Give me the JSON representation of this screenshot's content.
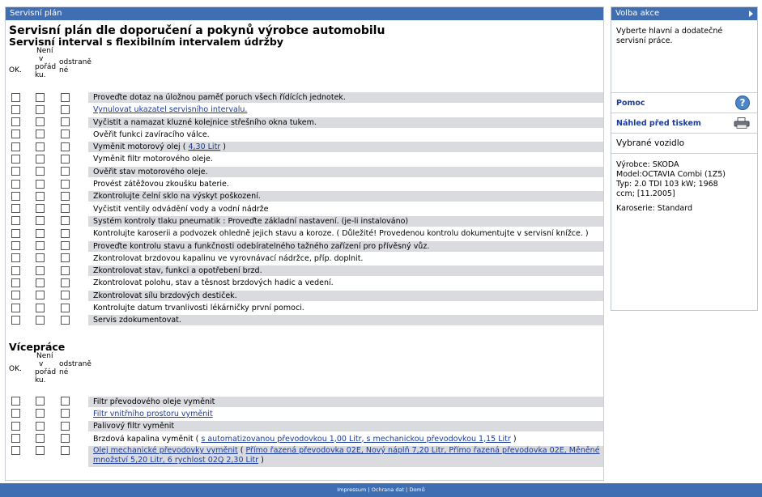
{
  "main": {
    "header": "Servisní plán",
    "title": "Servisní plán dle doporučení a pokynů výrobce automobilu",
    "subtitle": "Servisní interval s flexibilním intervalem údržby",
    "col_ok": "OK.",
    "col_neni_lines": [
      "Není",
      "v",
      "pořád",
      "ku."
    ],
    "col_odstranene_lines": [
      "odstraně",
      "né"
    ],
    "items": [
      {
        "text": "Proveďte dotaz na úložnou paměť poruch všech řídících jednotek."
      },
      {
        "link": "Vynulovat ukazatel servisního intervalu."
      },
      {
        "text": "Vyčistit a namazat kluzné kolejnice střešního okna tukem."
      },
      {
        "text": "Ověřit funkci zavíracího válce."
      },
      {
        "text": "Vyměnit motorový olej",
        "pre": "(",
        "link": "4,30 Litr",
        "post": ")"
      },
      {
        "text": "Vyměnit filtr motorového oleje."
      },
      {
        "text": "Ověřit stav motorového oleje."
      },
      {
        "text": "Provést zátěžovou zkoušku baterie."
      },
      {
        "text": "Zkontrolujte čelní sklo na výskyt poškození."
      },
      {
        "text": "Vyčistit ventily odvádění vody a vodní nádrže"
      },
      {
        "text": "Systém kontroly tlaku pneumatik : Proveďte základní nastavení. (je-li instalováno)"
      },
      {
        "text": "Kontrolujte karoserii a podvozek ohledně jejich stavu a koroze. ( Důležité! Provedenou kontrolu dokumentujte v servisní knížce. )"
      },
      {
        "text": "Proveďte kontrolu stavu a funkčnosti odebíratelného tažného zařízení pro přívěsný vůz."
      },
      {
        "text": "Zkontrolovat brzdovou kapalinu ve vyrovnávací nádržce, příp. doplnit."
      },
      {
        "text": "Zkontrolovat stav, funkci a opotřebení brzd."
      },
      {
        "text": "Zkontrolovat polohu, stav a těsnost brzdových hadic a vedení."
      },
      {
        "text": "Zkontrolovat sílu brzdových destiček."
      },
      {
        "text": "Kontrolujte datum trvanlivosti lékárničky první pomoci."
      },
      {
        "text": "Servis zdokumentovat."
      }
    ],
    "extra_title": "Vícepráce",
    "extra_items": [
      {
        "text": "Filtr převodového oleje vyměnit"
      },
      {
        "link": "Filtr vnitřního prostoru vyměnit"
      },
      {
        "text": "Palivový filtr vyměnit"
      },
      {
        "text": "Brzdová kapalina vyměnit",
        "pre": "(",
        "link": "s automatizovanou převodovkou 1,00 Litr, s mechanickou převodovkou 1,15 Litr",
        "post": ")"
      },
      {
        "link": "Olej mechanické převodovky vyměnit",
        "pre": "(",
        "link2": "Přímo řazená převodovka 02E, Nový náplň 7,20 Litr, Přímo řazená převodovka 02E, Měněné množství 5,20 Litr, 6 rychlost 02Q 2,30 Litr",
        "post": ")"
      }
    ]
  },
  "sidebar": {
    "header": "Volba akce",
    "description": "Vyberte hlavní a dodatečné servisní práce.",
    "help_label": "Pomoc",
    "print_label": "Náhled před tiskem",
    "vehicle_title": "Vybrané vozidlo",
    "vehicle_lines": [
      "Výrobce: SKODA",
      "Model:OCTAVIA Combi (1Z5)",
      "Typ: 2.0 TDI 103 kW; 1968",
      "ccm; [11.2005]"
    ],
    "body_line": "Karoserie: Standard"
  },
  "footer": {
    "text": "Impressum | Ochrana dat | Domů"
  },
  "colors": {
    "accent": "#3f6eb2",
    "row_alt": "#d9dbdf",
    "link": "#1b3b9b"
  },
  "icons": {
    "help": "help-icon",
    "print": "print-icon",
    "arrow": "arrow-right-icon"
  }
}
